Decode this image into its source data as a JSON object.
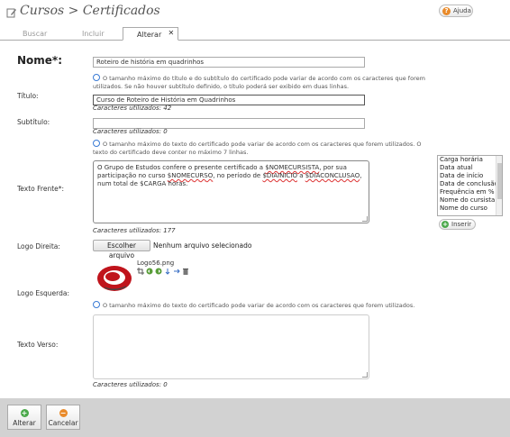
{
  "header": {
    "title": "Cursos > Certificados",
    "help_label": "Ajuda"
  },
  "tabs": [
    {
      "label": "Buscar"
    },
    {
      "label": "Incluir"
    },
    {
      "label": "Alterar",
      "close": "✕"
    }
  ],
  "form": {
    "nome": {
      "label": "Nome*:",
      "value": "Roteiro de história em quadrinhos"
    },
    "title_hint": "O tamanho máximo do título e do subtítulo do certificado pode variar de acordo com os caracteres que forem utilizados. Se não houver subtítulo definido, o título poderá ser exibido em duas linhas.",
    "titulo": {
      "label": "Título:",
      "value": "Curso de Roteiro de História em Quadrinhos",
      "counter": "Caracteres utilizados: 42"
    },
    "subtitulo": {
      "label": "Subtítulo:",
      "value": "",
      "counter": "Caracteres utilizados: 0"
    },
    "front_hint": "O tamanho máximo do texto do certificado pode variar de acordo com os caracteres que forem utilizados. O texto do certificado deve conter no máximo 7 linhas.",
    "texto_frente": {
      "label": "Texto Frente*:",
      "segments": [
        "O Grupo de Estudos confere o presente certificado a ",
        "$NOMECURSISTA",
        ", por sua participação no curso ",
        "$NOMECURSO",
        ", no período de ",
        "$DIAINICIO",
        " a ",
        "$DIACONCLUSAO",
        ", num total de $CARGA horas."
      ],
      "counter": "Caracteres utilizados: 177"
    },
    "variables": [
      "Carga horária",
      "Data atual",
      "Data de início",
      "Data de conclusão",
      "Frequência em %",
      "Nome do cursista",
      "Nome do curso"
    ],
    "insert_label": "Inserir",
    "logo_direita": {
      "label": "Logo Direita:",
      "button": "Escolher arquivo",
      "status": "Nenhum arquivo selecionado"
    },
    "logo_esquerda": {
      "label": "Logo Esquerda:",
      "filename": "Logo56.png"
    },
    "back_hint": "O tamanho máximo do texto do certificado pode variar de acordo com os caracteres que forem utilizados.",
    "texto_verso": {
      "label": "Texto Verso:",
      "value": "",
      "counter": "Caracteres utilizados: 0"
    }
  },
  "footer": {
    "save_label": "Alterar",
    "cancel_label": "Cancelar"
  },
  "colors": {
    "footer_bg": "#d2d2d2",
    "help_icon": "#e98b2b",
    "add_icon": "#4aa84a",
    "logo_red": "#c0141c"
  }
}
